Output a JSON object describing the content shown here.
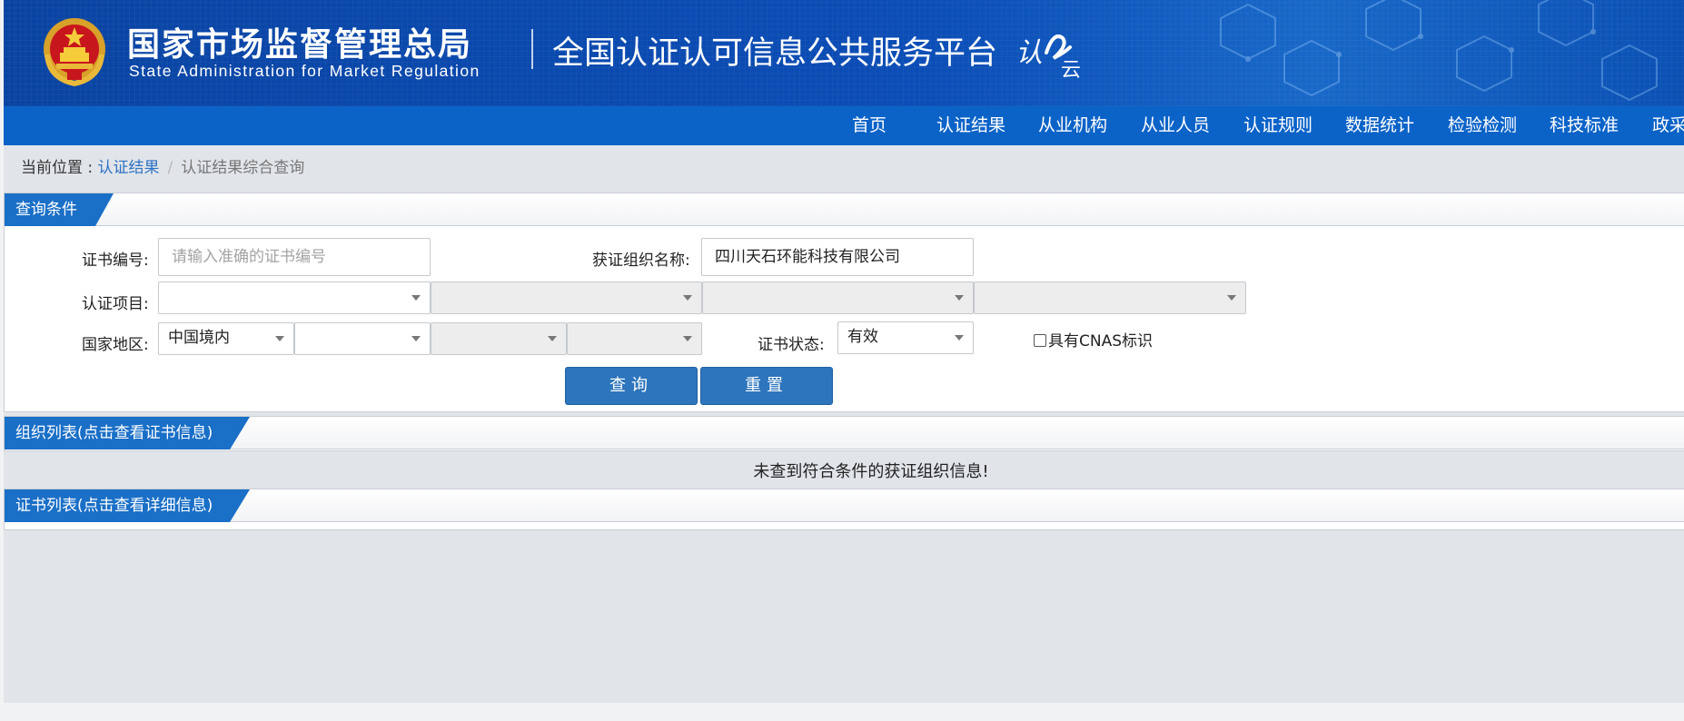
{
  "header": {
    "agency_cn": "国家市场监督管理总局",
    "agency_en": "State Administration  for  Market Regulation",
    "platform_title": "全国认证认可信息公共服务平台",
    "logo_text_left": "认",
    "logo_text_right": "云"
  },
  "nav": {
    "items": [
      "首页",
      "认证结果",
      "从业机构",
      "从业人员",
      "认证规则",
      "数据统计",
      "检验检测",
      "科技标准",
      "政采"
    ]
  },
  "breadcrumb": {
    "prefix": "当前位置 : ",
    "link": "认证结果",
    "separator": "/",
    "current": "认证结果综合查询"
  },
  "query_panel": {
    "title": "查询条件",
    "cert_no_label": "证书编号:",
    "cert_no_placeholder": "请输入准确的证书编号",
    "org_name_label": "获证组织名称:",
    "org_name_value": "四川天石环能科技有限公司",
    "cert_project_label": "认证项目:",
    "region_label": "国家地区:",
    "region_value": "中国境内",
    "status_label": "证书状态:",
    "status_value": "有效",
    "cnas_label": "具有CNAS标识",
    "search_button": "查询",
    "reset_button": "重置"
  },
  "org_panel": {
    "title": "组织列表(点击查看证书信息)",
    "empty_message": "未查到符合条件的获证组织信息!"
  },
  "cert_panel": {
    "title": "证书列表(点击查看详细信息)"
  },
  "colors": {
    "header_blue": "#0b4db6",
    "nav_blue": "#0b63c8",
    "tab_blue": "#1a6fc7",
    "button_blue": "#2d75bc",
    "link_blue": "#2f73c4"
  }
}
